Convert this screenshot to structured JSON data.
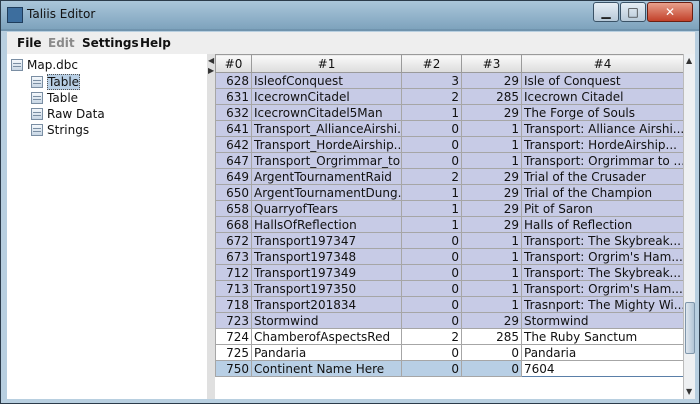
{
  "window": {
    "title": "Taliis Editor"
  },
  "menu": [
    "File",
    "Edit",
    "Settings",
    "Help"
  ],
  "tree": {
    "root": "Map.dbc",
    "children": [
      "Table",
      "Table",
      "Raw Data",
      "Strings"
    ]
  },
  "table": {
    "columns": [
      "#0",
      "#1",
      "#2",
      "#3",
      "#4"
    ],
    "rows": [
      [
        "628",
        "IsleofConquest",
        "3",
        "29",
        "Isle of Conquest"
      ],
      [
        "631",
        "IcecrownCitadel",
        "2",
        "285",
        "Icecrown Citadel"
      ],
      [
        "632",
        "IcecrownCitadel5Man",
        "1",
        "29",
        "The Forge of Souls"
      ],
      [
        "641",
        "Transport_AllianceAirshi...",
        "0",
        "1",
        "Transport: Alliance Airshi..."
      ],
      [
        "642",
        "Transport_HordeAirship...",
        "0",
        "1",
        "Transport: HordeAirship..."
      ],
      [
        "647",
        "Transport_Orgrimmar_to...",
        "0",
        "1",
        "Transport: Orgrimmar to ..."
      ],
      [
        "649",
        "ArgentTournamentRaid",
        "2",
        "29",
        "Trial of the Crusader"
      ],
      [
        "650",
        "ArgentTournamentDung...",
        "1",
        "29",
        "Trial of the Champion"
      ],
      [
        "658",
        "QuarryofTears",
        "1",
        "29",
        "Pit of Saron"
      ],
      [
        "668",
        "HallsOfReflection",
        "1",
        "29",
        "Halls of Reflection"
      ],
      [
        "672",
        "Transport197347",
        "0",
        "1",
        "Transport: The Skybreak..."
      ],
      [
        "673",
        "Transport197348",
        "0",
        "1",
        "Transport: Orgrim's Ham..."
      ],
      [
        "712",
        "Transport197349",
        "0",
        "1",
        "Transport: The Skybreak..."
      ],
      [
        "713",
        "Transport197350",
        "0",
        "1",
        "Transport: Orgrim's Ham..."
      ],
      [
        "718",
        "Transport201834",
        "0",
        "1",
        "Trasnport: The Mighty Wi..."
      ],
      [
        "723",
        "Stormwind",
        "0",
        "29",
        "Stormwind"
      ],
      [
        "724",
        "ChamberofAspectsRed",
        "2",
        "285",
        "The Ruby Sanctum"
      ],
      [
        "725",
        "Pandaria",
        "0",
        "0",
        "Pandaria"
      ],
      [
        "750",
        "Continent Name Here",
        "0",
        "0",
        "7604"
      ]
    ]
  }
}
